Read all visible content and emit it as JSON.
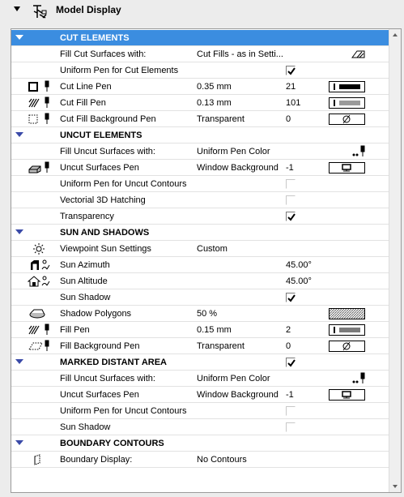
{
  "panel": {
    "title": "Model Display"
  },
  "sections": {
    "cut": {
      "title": "CUT ELEMENTS",
      "fill_label": "Fill Cut Surfaces with:",
      "fill_value": "Cut Fills - as in Setti...",
      "uniform_label": "Uniform Pen for Cut Elements",
      "uniform_checked": true,
      "line_pen_label": "Cut Line Pen",
      "line_pen_size": "0.35 mm",
      "line_pen_num": "21",
      "fill_pen_label": "Cut Fill Pen",
      "fill_pen_size": "0.13 mm",
      "fill_pen_num": "101",
      "bg_pen_label": "Cut Fill Background Pen",
      "bg_pen_value": "Transparent",
      "bg_pen_num": "0"
    },
    "uncut": {
      "title": "UNCUT ELEMENTS",
      "fill_label": "Fill Uncut Surfaces with:",
      "fill_value": "Uniform Pen Color",
      "surf_pen_label": "Uncut Surfaces Pen",
      "surf_pen_value": "Window Background",
      "surf_pen_num": "-1",
      "uniform_contour_label": "Uniform Pen for Uncut Contours",
      "uniform_contour_checked": false,
      "vectorial_label": "Vectorial 3D Hatching",
      "vectorial_checked": false,
      "transparency_label": "Transparency",
      "transparency_checked": true
    },
    "sun": {
      "title": "SUN AND SHADOWS",
      "viewpoint_label": "Viewpoint Sun Settings",
      "viewpoint_value": "Custom",
      "azimuth_label": "Sun Azimuth",
      "azimuth_value": "45.00°",
      "altitude_label": "Sun Altitude",
      "altitude_value": "45.00°",
      "shadow_label": "Sun Shadow",
      "shadow_checked": true,
      "polygons_label": "Shadow Polygons",
      "polygons_value": "50 %",
      "fill_pen_label": "Fill Pen",
      "fill_pen_size": "0.15 mm",
      "fill_pen_num": "2",
      "bg_pen_label": "Fill Background Pen",
      "bg_pen_value": "Transparent",
      "bg_pen_num": "0"
    },
    "marked": {
      "title": "MARKED DISTANT AREA",
      "title_checked": true,
      "fill_label": "Fill Uncut Surfaces with:",
      "fill_value": "Uniform Pen Color",
      "surf_pen_label": "Uncut Surfaces Pen",
      "surf_pen_value": "Window Background",
      "surf_pen_num": "-1",
      "uniform_contour_label": "Uniform Pen for Uncut Contours",
      "uniform_contour_checked": false,
      "shadow_label": "Sun Shadow",
      "shadow_checked": false
    },
    "boundary": {
      "title": "BOUNDARY CONTOURS",
      "display_label": "Boundary Display:",
      "display_value": "No Contours"
    }
  },
  "colors": {
    "selection": "#3b8de0",
    "section_arrow": "#3a4aa8"
  }
}
